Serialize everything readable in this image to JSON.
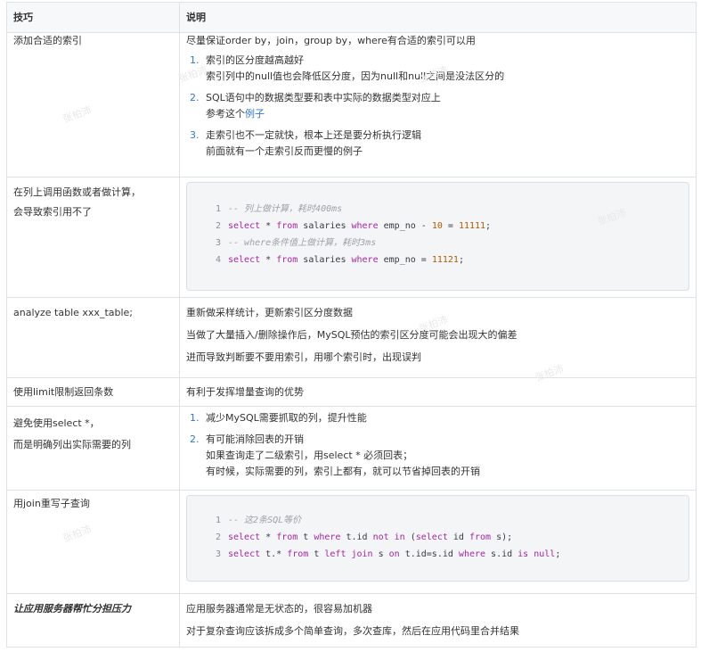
{
  "headers": [
    "技巧",
    "说明"
  ],
  "rows": {
    "r1": {
      "tip": "添加合适的索引",
      "intro": "尽量保证order by，join，group by，where有合适的索引可以用",
      "items": [
        {
          "num": "1.",
          "line1": "索引的区分度越高越好",
          "line2": "索引列中的null值也会降低区分度，因为null和null之间是没法区分的"
        },
        {
          "num": "2.",
          "line1": "SQL语句中的数据类型要和表中实际的数据类型对应上",
          "line2_prefix": "参考这个",
          "line2_link": "例子"
        },
        {
          "num": "3.",
          "line1": "走索引也不一定就快，根本上还是要分析执行逻辑",
          "line2": "前面就有一个走索引反而更慢的例子"
        }
      ]
    },
    "r2": {
      "tip_line1": "在列上调用函数或者做计算，",
      "tip_line2": "会导致索引用不了",
      "code": {
        "l1_num": "1",
        "l1_comment": "-- 列上做计算，耗时400ms",
        "l2_num": "2",
        "l2_kw1": "select",
        "l2_t1": " * ",
        "l2_kw2": "from",
        "l2_t2": " salaries ",
        "l2_kw3": "where",
        "l2_t3": " emp_no - ",
        "l2_n1": "10",
        "l2_t4": " = ",
        "l2_n2": "11111",
        "l2_t5": ";",
        "l3_num": "3",
        "l3_comment": "-- where条件值上做计算，耗时3ms",
        "l4_num": "4",
        "l4_kw1": "select",
        "l4_t1": " * ",
        "l4_kw2": "from",
        "l4_t2": " salaries ",
        "l4_kw3": "where",
        "l4_t3": " emp_no = ",
        "l4_n1": "11121",
        "l4_t4": ";"
      }
    },
    "r3": {
      "tip": "analyze table xxx_table;",
      "p1": "重新做采样统计，更新索引区分度数据",
      "p2": "当做了大量插入/删除操作后，MySQL预估的索引区分度可能会出现大的偏差",
      "p3": "进而导致判断要不要用索引，用哪个索引时，出现误判"
    },
    "r4": {
      "tip": "使用limit限制返回条数",
      "desc": "有利于发挥增量查询的优势"
    },
    "r5": {
      "tip_line1": "避免使用select *，",
      "tip_line2": "而是明确列出实际需要的列",
      "items": [
        {
          "num": "1.",
          "line1": "减少MySQL需要抓取的列，提升性能"
        },
        {
          "num": "2.",
          "line1": "有可能消除回表的开销",
          "line2": "如果查询走了二级索引，用select * 必须回表；",
          "line3": "有时候，实际需要的列，索引上都有，就可以节省掉回表的开销"
        }
      ]
    },
    "r6": {
      "tip": "用join重写子查询",
      "code": {
        "l1_num": "1",
        "l1_comment": "-- 这2条SQL等价",
        "l2_num": "2",
        "l2_kw1": "select",
        "l2_t1": " * ",
        "l2_kw2": "from",
        "l2_t2": " t ",
        "l2_kw3": "where",
        "l2_t3": " t.id ",
        "l2_kw4": "not in",
        "l2_t4": " (",
        "l2_kw5": "select",
        "l2_t5": " id ",
        "l2_kw6": "from",
        "l2_t6": " s);",
        "l3_num": "3",
        "l3_kw1": "select",
        "l3_t1": " t.* ",
        "l3_kw2": "from",
        "l3_t2": " t ",
        "l3_kw3": "left join",
        "l3_t3": " s ",
        "l3_kw4": "on",
        "l3_t4": " t.id=s.id ",
        "l3_kw5": "where",
        "l3_t5": " s.id ",
        "l3_kw6": "is null",
        "l3_t6": ";"
      }
    },
    "r7": {
      "tip": "让应用服务器帮忙分担压力",
      "p1": "应用服务器通常是无状态的，很容易加机器",
      "p2": "对于复杂查询应该拆成多个简单查询，多次查库，然后在应用代码里合并结果"
    }
  },
  "watermark": "张柏沛",
  "colors": {
    "link": "#2f77d1",
    "keyword": "#a626a4",
    "number": "#b05a00",
    "comment": "#a0a1a7"
  }
}
